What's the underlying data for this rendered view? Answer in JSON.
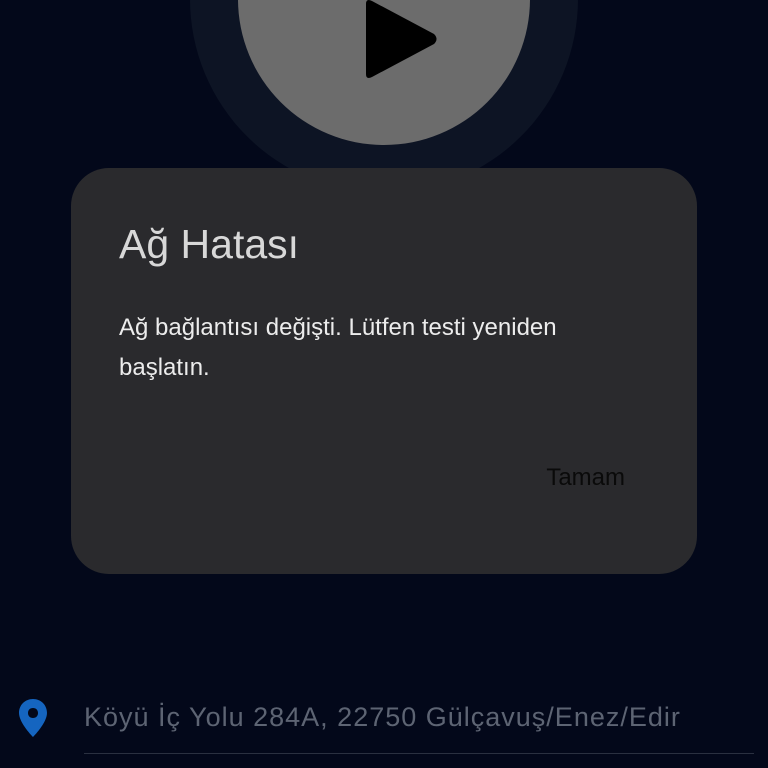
{
  "dialog": {
    "title": "Ağ Hatası",
    "message": "Ağ bağlantısı değişti. Lütfen testi yeniden başlatın.",
    "ok_label": "Tamam"
  },
  "location": {
    "address": "Köyü İç Yolu 284A, 22750 Gülçavuş/Enez/Edir",
    "icon": "location-pin-icon"
  },
  "play_button": {
    "icon": "play-icon"
  },
  "colors": {
    "background": "#03081a",
    "dialog": "#2a2a2d",
    "play_button": "#6c6c6c",
    "location_pin": "#1565c0"
  }
}
